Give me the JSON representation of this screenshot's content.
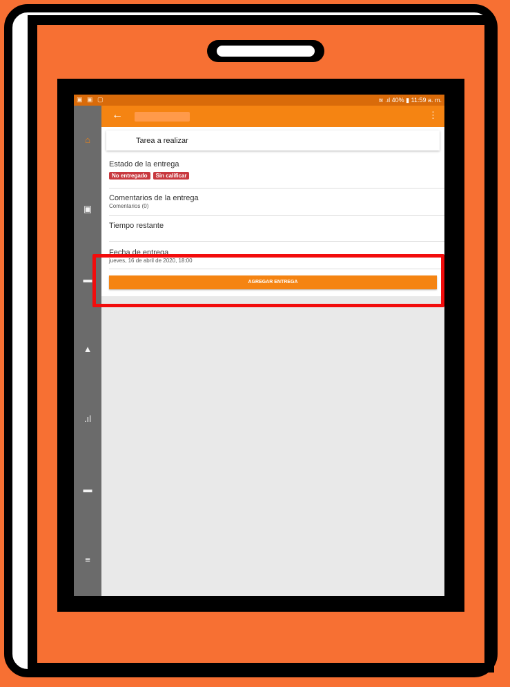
{
  "status_bar": {
    "left_icons": "▣ ▣ ▢",
    "right_text": "40% ▮ 11:59 a. m.",
    "wifi_signal": "≋ .ıl"
  },
  "appbar": {
    "back_icon": "←",
    "menu_icon": "⋮",
    "title": ""
  },
  "sidebar": {
    "icons": [
      "home-icon",
      "calendar-icon",
      "chat-icon",
      "bell-icon",
      "chart-icon",
      "folder-icon",
      "hamburger-icon"
    ]
  },
  "task": {
    "title": "Tarea a realizar"
  },
  "delivery_status": {
    "label": "Estado de la entrega",
    "badges": [
      "No entregado",
      "Sin calificar"
    ]
  },
  "comments": {
    "label": "Comentarios de la entrega",
    "sub": "Comentarios (0)"
  },
  "time_left": {
    "label": "Tiempo restante"
  },
  "due_date": {
    "label": "Fecha de entrega",
    "value": "jueves, 16 de abril de 2020, 18:00"
  },
  "submit_button": {
    "label": "AGREGAR ENTREGA"
  },
  "colors": {
    "accent": "#f58412",
    "badge": "#c8393f",
    "highlight": "#f20c0c"
  }
}
